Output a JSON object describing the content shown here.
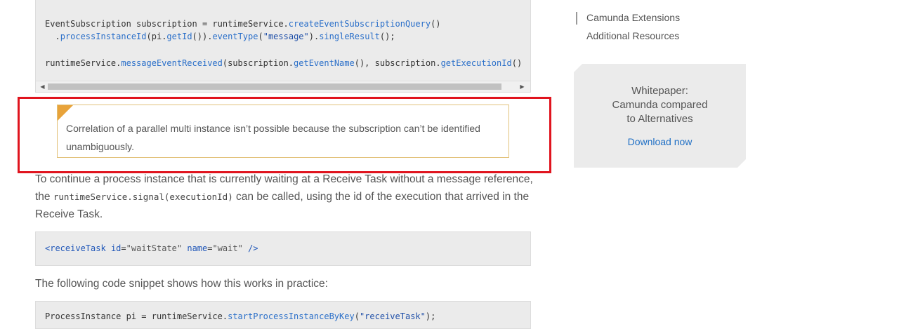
{
  "code1": {
    "line1_a": "EventSubscription subscription = runtimeService.",
    "line1_method": "createEventSubscriptionQuery",
    "line1_b": "()",
    "line2_a": "  .",
    "line2_m1": "processInstanceId",
    "line2_b": "(pi.",
    "line2_m2": "getId",
    "line2_c": "()).",
    "line2_m3": "eventType",
    "line2_d": "(",
    "line2_str": "\"message\"",
    "line2_e": ").",
    "line2_m4": "singleResult",
    "line2_f": "();",
    "line3_a": "runtimeService.",
    "line3_m1": "messageEventReceived",
    "line3_b": "(subscription.",
    "line3_m2": "getEventName",
    "line3_c": "(), subscription.",
    "line3_m3": "getExecutionId",
    "line3_d": "()"
  },
  "scrollbar": {
    "left_arrow": "◀",
    "right_arrow": "▶"
  },
  "note": {
    "text": "Correlation of a parallel multi instance isn’t possible because the subscription can’t be identified unambiguously."
  },
  "para1": {
    "before": "To continue a process instance that is currently waiting at a Receive Task without a message reference, the ",
    "code": "runtimeService.signal(executionId)",
    "after": " can be called, using the id of the execution that arrived in the Receive Task."
  },
  "code2": {
    "open": "<",
    "tag": "receiveTask",
    "attr1": " id",
    "eq1": "=",
    "val1": "\"waitState\"",
    "attr2": " name",
    "eq2": "=",
    "val2": "\"wait\"",
    "close": " />"
  },
  "para2": {
    "text": "The following code snippet shows how this works in practice:"
  },
  "code3": {
    "a": "ProcessInstance pi = runtimeService.",
    "method": "startProcessInstanceByKey",
    "b": "(",
    "str": "\"receiveTask\"",
    "c": ");"
  },
  "toc": {
    "items": [
      "Camunda Extensions",
      "Additional Resources"
    ]
  },
  "promo": {
    "title": "Whitepaper: Camunda compared to Alternatives",
    "link": "Download now"
  },
  "colors": {
    "highlight": "#e0141e",
    "note_border": "#e2c27a",
    "note_corner": "#e8a33a",
    "link": "#1f6fc5",
    "code_method": "#2a6fc9"
  }
}
